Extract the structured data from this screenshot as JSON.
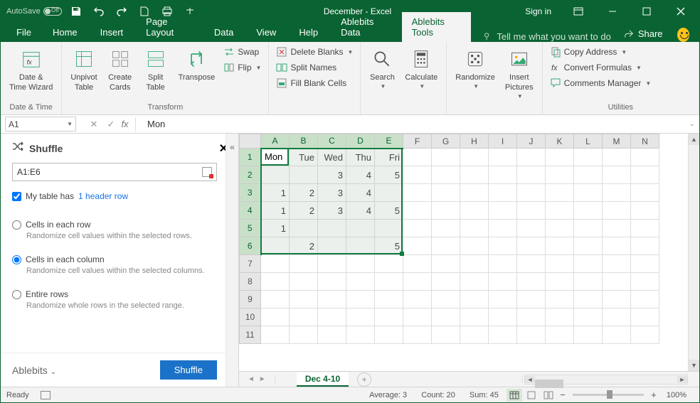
{
  "titlebar": {
    "autosave_label": "AutoSave",
    "title": "December - Excel",
    "signin": "Sign in"
  },
  "tabs": [
    "File",
    "Home",
    "Insert",
    "Page Layout",
    "Data",
    "View",
    "Help",
    "Ablebits Data",
    "Ablebits Tools"
  ],
  "active_tab": "Ablebits Tools",
  "tellme": "Tell me what you want to do",
  "share": "Share",
  "ribbon": {
    "group1": {
      "date_time_wizard": "Date &\nTime Wizard",
      "label": "Date & Time"
    },
    "group2": {
      "unpivot": "Unpivot\nTable",
      "create_cards": "Create\nCards",
      "split_table": "Split\nTable",
      "transpose": "Transpose",
      "swap": "Swap",
      "flip": "Flip",
      "label": "Transform"
    },
    "group3": {
      "delete_blanks": "Delete Blanks",
      "split_names": "Split Names",
      "fill_blank": "Fill Blank Cells"
    },
    "group4": {
      "search": "Search",
      "calculate": "Calculate"
    },
    "group5": {
      "randomize": "Randomize",
      "insert_pics": "Insert\nPictures"
    },
    "group6": {
      "copy_address": "Copy Address",
      "convert_formulas": "Convert Formulas",
      "comments_mgr": "Comments Manager",
      "label": "Utilities"
    }
  },
  "namebox": "A1",
  "formula": "Mon",
  "pane": {
    "title": "Shuffle",
    "range": "A1:E6",
    "checkbox_label": "My table has",
    "checkbox_link": "1 header row",
    "opt1_title": "Cells in each row",
    "opt1_desc": "Randomize cell values within the selected rows.",
    "opt2_title": "Cells in each column",
    "opt2_desc": "Randomize cell values within the selected columns.",
    "opt3_title": "Entire rows",
    "opt3_desc": "Randomize whole rows in the selected range.",
    "footer_link": "Ablebits",
    "button": "Shuffle"
  },
  "grid": {
    "columns": [
      "A",
      "B",
      "C",
      "D",
      "E",
      "F",
      "G",
      "H",
      "I",
      "J",
      "K",
      "L",
      "M",
      "N"
    ],
    "rows": [
      1,
      2,
      3,
      4,
      5,
      6,
      7,
      8,
      9,
      10,
      11
    ],
    "data": [
      [
        "Mon",
        "Tue",
        "Wed",
        "Thu",
        "Fri"
      ],
      [
        "",
        "",
        "3",
        "4",
        "5"
      ],
      [
        "1",
        "2",
        "3",
        "4",
        ""
      ],
      [
        "1",
        "2",
        "3",
        "4",
        "5"
      ],
      [
        "1",
        "",
        "",
        "",
        ""
      ],
      [
        "",
        "2",
        "",
        "",
        "5"
      ]
    ]
  },
  "sheet_tabs": {
    "active": "Dec 4-10"
  },
  "statusbar": {
    "ready": "Ready",
    "average": "Average: 3",
    "count": "Count: 20",
    "sum": "Sum: 45",
    "zoom": "100%"
  },
  "chart_data": {
    "type": "table",
    "columns": [
      "Mon",
      "Tue",
      "Wed",
      "Thu",
      "Fri"
    ],
    "rows": [
      [
        null,
        null,
        3,
        4,
        5
      ],
      [
        1,
        2,
        3,
        4,
        null
      ],
      [
        1,
        2,
        3,
        4,
        5
      ],
      [
        1,
        null,
        null,
        null,
        null
      ],
      [
        null,
        2,
        null,
        null,
        5
      ]
    ]
  }
}
